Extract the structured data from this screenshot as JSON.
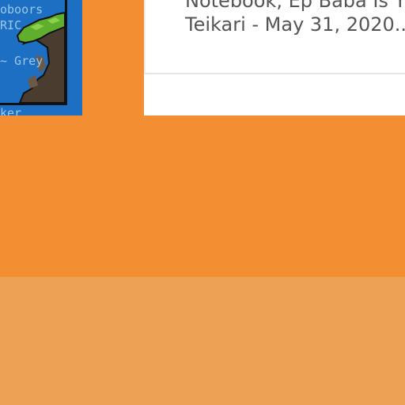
{
  "thumbnail": {
    "text_lines": [
      "oboors",
      "RIC",
      "~ Grey",
      "ker"
    ],
    "icon": "pixel-art-cliff-icon"
  },
  "article": {
    "title_line1": "Notebook, Ep Baba Is Y",
    "byline": "Teikari - May 31, 2020..."
  },
  "colors": {
    "page_background": "#f38e33",
    "lower_band": "#eda155",
    "card_background": "#ffffff",
    "thumbnail_background": "#1d6fc4"
  }
}
